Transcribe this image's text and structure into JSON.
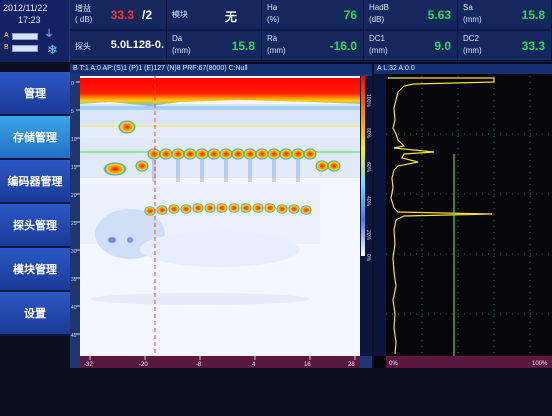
{
  "clock": {
    "date": "2012/11/22",
    "time": "17:23"
  },
  "battery": {
    "a_label": "A",
    "b_label": "B"
  },
  "header": {
    "gain": {
      "k1": "增益",
      "k2": "( dB)",
      "value": "33.3",
      "suffix": "/2"
    },
    "block": {
      "k1": "模块",
      "value": "无"
    },
    "ha": {
      "k1": "Ha",
      "k2": "(%)",
      "value": "76"
    },
    "hadb": {
      "k1": "HadB",
      "k2": "(dB)",
      "value": "5.63"
    },
    "sa": {
      "k1": "Sa",
      "k2": "(mm)",
      "value": "15.8"
    },
    "probe": {
      "k1": "探头",
      "value": "5.0L128-0."
    },
    "da": {
      "k1": "Da",
      "k2": "(mm)",
      "value": "15.8"
    },
    "ra": {
      "k1": "Ra",
      "k2": "(mm)",
      "value": "-16.0"
    },
    "dc1": {
      "k1": "DC1",
      "k2": "(mm)",
      "value": "9.0"
    },
    "dc2": {
      "k1": "DC2",
      "k2": "(mm)",
      "value": "33.3"
    }
  },
  "menu": [
    {
      "label": "管理"
    },
    {
      "label": "存储管理"
    },
    {
      "label": "编码器管理"
    },
    {
      "label": "探头管理"
    },
    {
      "label": "模块管理"
    },
    {
      "label": "设置"
    }
  ],
  "bscan": {
    "header": "B  T:1 A:0 AP:(S)1 (P)1 (E)127 (N)8 PRF:67(8000) C:Null",
    "left_ticks": [
      "0",
      "5",
      "10",
      "15",
      "20",
      "25",
      "30",
      "35",
      "40",
      "45",
      "50"
    ],
    "bottom_ticks": [
      "-32",
      "-20",
      "-8",
      "4",
      "16",
      "28"
    ],
    "color_ticks": [
      "100%",
      "80%",
      "60%",
      "40%",
      "20%",
      "0%"
    ]
  },
  "ascan": {
    "header": "A    L:32 A:0.0",
    "bottom_ticks": [
      "0%",
      "100%"
    ]
  },
  "colors": {
    "panel_blue": "#1d3672",
    "accent_green": "#2cd95a",
    "cursor_red": "#ff3a3a"
  }
}
